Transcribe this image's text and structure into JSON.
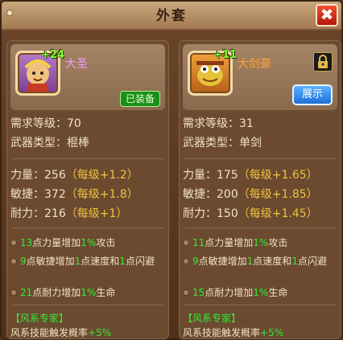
{
  "window": {
    "title": "外套",
    "close_label": "✖"
  },
  "left": {
    "plus": "+24",
    "name": "大圣",
    "badge": "已装备",
    "level_label": "需求等级：",
    "level_value": "70",
    "weapon_label": "武器类型：",
    "weapon_value": "棍棒",
    "stats": [
      {
        "label": "力量：",
        "value": "256",
        "level_text": "（每级+1.2）"
      },
      {
        "label": "敏捷：",
        "value": "372",
        "level_text": "（每级+1.8）"
      },
      {
        "label": "耐力：",
        "value": "216",
        "level_text": "（每级+1）"
      }
    ],
    "bonus1": {
      "a": "13",
      "b": "点力量增加",
      "c": "1%",
      "d": "攻击"
    },
    "bonus2": {
      "a": "9",
      "b": "点敏捷增加",
      "c": "1",
      "d": "点速度和",
      "e": "1",
      "f": "点闪避"
    },
    "bonus3": {
      "a": "21",
      "b": "点耐力增加",
      "c": "1%",
      "d": "生命"
    },
    "expert_title": "【风系专家】",
    "expert_text": "风系技能触发概率",
    "expert_value": "+5%"
  },
  "right": {
    "plus": "+11",
    "name": "大剑豪",
    "button": "展示",
    "level_label": "需求等级：",
    "level_value": "31",
    "weapon_label": "武器类型：",
    "weapon_value": "单剑",
    "stats": [
      {
        "label": "力量：",
        "value": "175",
        "level_text": "（每级+1.65）"
      },
      {
        "label": "敏捷：",
        "value": "200",
        "level_text": "（每级+1.85）"
      },
      {
        "label": "耐力：",
        "value": "150",
        "level_text": "（每级+1.45）"
      }
    ],
    "bonus1": {
      "a": "11",
      "b": "点力量增加",
      "c": "1%",
      "d": "攻击"
    },
    "bonus2": {
      "a": "9",
      "b": "点敏捷增加",
      "c": "1",
      "d": "点速度和",
      "e": "1",
      "f": "点闪避"
    },
    "bonus3": {
      "a": "15",
      "b": "点耐力增加",
      "c": "1%",
      "d": "生命"
    },
    "expert_title": "【风系专家】",
    "expert_text": "风系技能触发概率",
    "expert_value": "+5%"
  },
  "icons": {
    "close": "close-icon",
    "lock": "lock-icon",
    "dot": "bullet-icon"
  },
  "colors": {
    "green": "#35e935",
    "gold": "#f0c23e",
    "text": "#f3e2c3",
    "brown": "#6b4a30"
  }
}
